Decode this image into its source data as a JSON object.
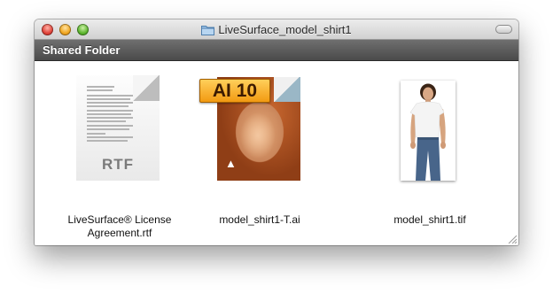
{
  "window": {
    "title": "LiveSurface_model_shirt1",
    "path_label": "Shared Folder"
  },
  "files": [
    {
      "name": "LiveSurface® License Agreement.rtf",
      "type_badge": "RTF",
      "icon": "rtf-document-icon"
    },
    {
      "name": "model_shirt1-T.ai",
      "type_badge": "AI 10",
      "icon": "illustrator-document-icon"
    },
    {
      "name": "model_shirt1.tif",
      "icon": "tif-image-thumbnail"
    }
  ],
  "colors": {
    "close": "#e0443a",
    "minimize": "#f0a620",
    "zoom": "#5cb52e",
    "pathbar": "#4a4a4a",
    "ai_badge": "#f29a12"
  }
}
